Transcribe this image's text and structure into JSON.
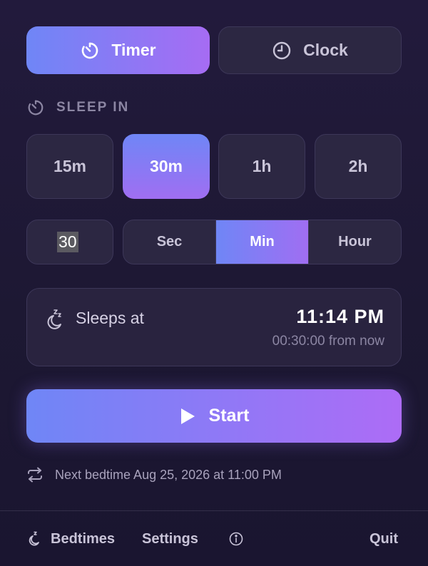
{
  "mode": {
    "timer_label": "Timer",
    "clock_label": "Clock",
    "selected": "Timer"
  },
  "section": {
    "label": "SLEEP IN"
  },
  "presets": [
    {
      "label": "15m"
    },
    {
      "label": "30m"
    },
    {
      "label": "1h"
    },
    {
      "label": "2h"
    }
  ],
  "presets_selected": "30m",
  "custom": {
    "value": "30",
    "units": [
      "Sec",
      "Min",
      "Hour"
    ],
    "selected_unit": "Min"
  },
  "card": {
    "label": "Sleeps at",
    "time": "11:14 PM",
    "countdown": "00:30:00 from now"
  },
  "start": {
    "label": "Start"
  },
  "next_bedtime": {
    "text": "Next bedtime Aug 25, 2026 at 11:00 PM"
  },
  "footer": {
    "bedtimes_label": "Bedtimes",
    "settings_label": "Settings",
    "quit_label": "Quit"
  },
  "colors": {
    "accent_start": "#6f86f6",
    "accent_end": "#a66cf3",
    "background": "#1d1833"
  },
  "icons": {
    "timer": "stopwatch-icon",
    "clock": "clock-icon",
    "section": "timer-icon",
    "moon": "moon-zzz-icon",
    "start": "play-icon",
    "repeat": "repeat-icon",
    "bedtimes": "moon-zzz-icon",
    "info": "info-icon"
  }
}
